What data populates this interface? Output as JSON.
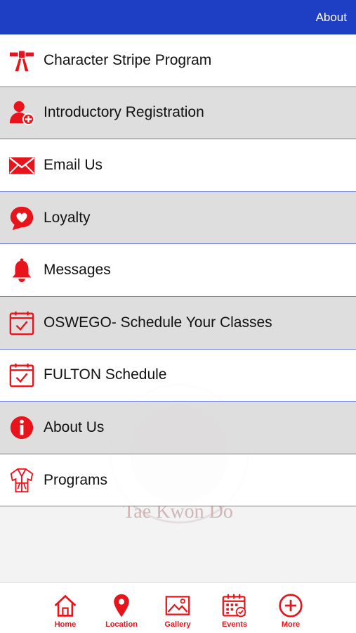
{
  "topbar": {
    "about_label": "About"
  },
  "menu": {
    "items": [
      {
        "label": "Character Stripe Program",
        "icon": "belt-icon"
      },
      {
        "label": "Introductory Registration",
        "icon": "add-user-icon"
      },
      {
        "label": "Email Us",
        "icon": "envelope-icon"
      },
      {
        "label": "Loyalty",
        "icon": "heart-chat-icon"
      },
      {
        "label": "Messages",
        "icon": "bell-icon"
      },
      {
        "label": "OSWEGO- Schedule Your Classes",
        "icon": "calendar-check-icon"
      },
      {
        "label": "FULTON Schedule",
        "icon": "calendar-check-icon"
      },
      {
        "label": "About Us",
        "icon": "info-icon"
      },
      {
        "label": "Programs",
        "icon": "uniform-icon"
      }
    ]
  },
  "watermark": {
    "text": "Tae Kwon Do"
  },
  "tabbar": {
    "tabs": [
      {
        "label": "Home",
        "icon": "home-icon"
      },
      {
        "label": "Location",
        "icon": "map-pin-icon"
      },
      {
        "label": "Gallery",
        "icon": "image-icon"
      },
      {
        "label": "Events",
        "icon": "calendar-grid-icon"
      },
      {
        "label": "More",
        "icon": "plus-circle-icon"
      }
    ]
  },
  "colors": {
    "accent": "#e8141c",
    "nav": "#1e3fc3",
    "divider": "#6a7ad9"
  }
}
